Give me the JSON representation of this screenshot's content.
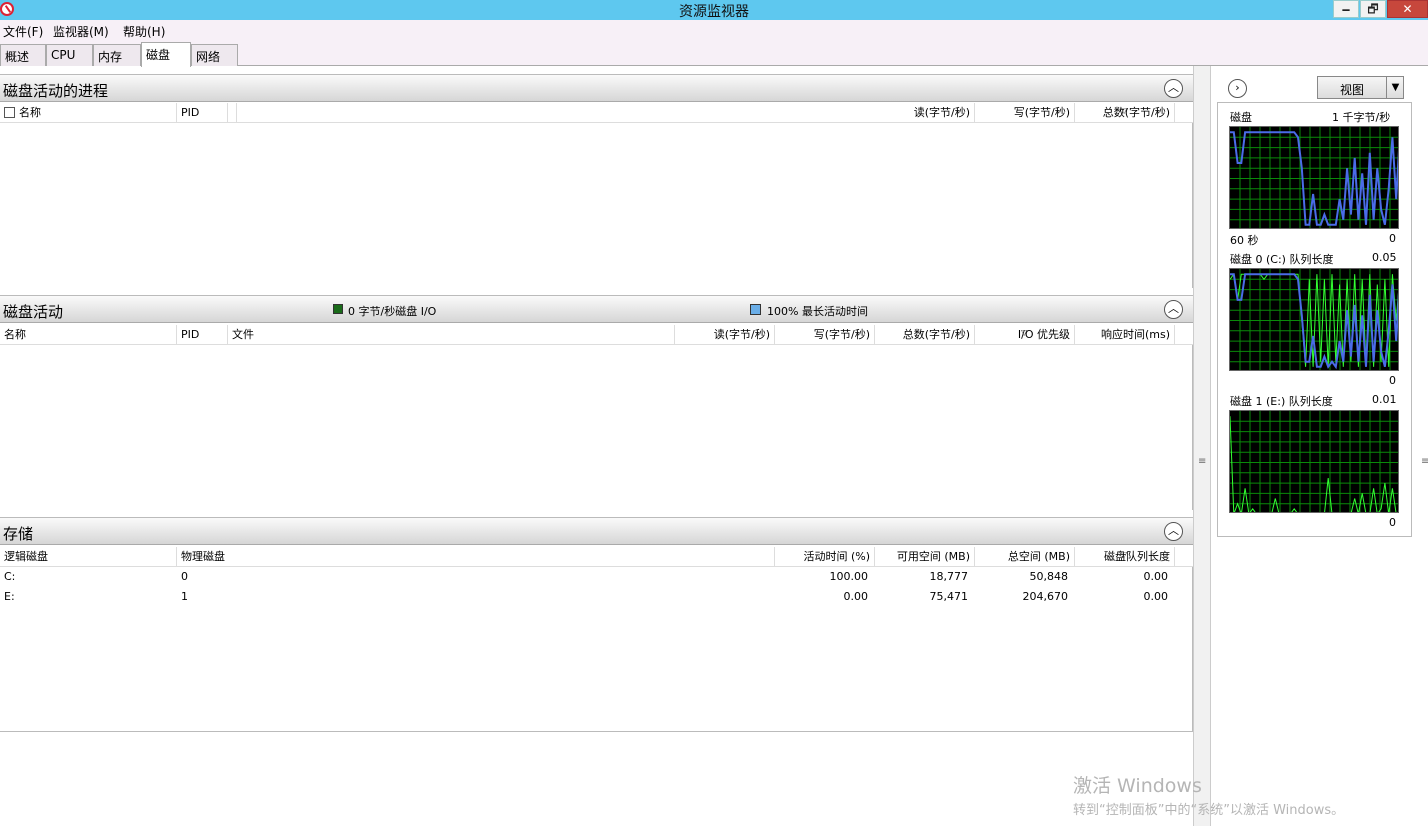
{
  "window": {
    "title": "资源监视器",
    "minimize": "🗕",
    "restore": "🗗",
    "close": "✕"
  },
  "menu": [
    "文件(F)",
    "监视器(M)",
    "帮助(H)"
  ],
  "tabs": [
    "概述",
    "CPU",
    "内存",
    "磁盘",
    "网络"
  ],
  "active_tab": "磁盘",
  "processes": {
    "title": "磁盘活动的进程",
    "columns": [
      "名称",
      "PID",
      "读(字节/秒)",
      "写(字节/秒)",
      "总数(字节/秒)"
    ]
  },
  "activity": {
    "title": "磁盘活动",
    "legend_io": "0 字节/秒磁盘 I/O",
    "legend_active": "100% 最长活动时间",
    "legend_io_color": "#1a6b1a",
    "legend_active_color": "#6aaee8",
    "columns": [
      "名称",
      "PID",
      "文件",
      "读(字节/秒)",
      "写(字节/秒)",
      "总数(字节/秒)",
      "I/O 优先级",
      "响应时间(ms)"
    ]
  },
  "storage": {
    "title": "存储",
    "columns": [
      "逻辑磁盘",
      "物理磁盘",
      "活动时间 (%)",
      "可用空间 (MB)",
      "总空间 (MB)",
      "磁盘队列长度"
    ],
    "rows": [
      {
        "logical": "C:",
        "physical": "0",
        "active": "100.00",
        "free": "18,777",
        "total": "50,848",
        "queue": "0.00"
      },
      {
        "logical": "E:",
        "physical": "1",
        "active": "0.00",
        "free": "75,471",
        "total": "204,670",
        "queue": "0.00"
      }
    ]
  },
  "right": {
    "view_label": "视图",
    "graphs": [
      {
        "label": "磁盘",
        "scale": "1 千字节/秒",
        "left_bottom": "60 秒",
        "right_bottom": "0"
      },
      {
        "label": "磁盘 0 (C:) 队列长度",
        "scale": "0.05",
        "left_bottom": "",
        "right_bottom": "0"
      },
      {
        "label": "磁盘 1 (E:) 队列长度",
        "scale": "0.01",
        "left_bottom": "",
        "right_bottom": "0"
      }
    ],
    "grid_color": "#0a8a0a",
    "green_line_color": "#33ff33",
    "blue_line_color": "#4a6ce8",
    "series": {
      "g1_blue": [
        0.95,
        0.95,
        0.65,
        0.65,
        0.95,
        0.95,
        0.95,
        0.95,
        0.95,
        0.95,
        0.95,
        0.95,
        0.95,
        0.95,
        0.95,
        0.95,
        0.95,
        0.95,
        0.9,
        0.6,
        0.05,
        0.05,
        0.35,
        0.05,
        0.05,
        0.15,
        0.05,
        0.05,
        0.05,
        0.3,
        0.1,
        0.6,
        0.15,
        0.7,
        0.1,
        0.55,
        0.05,
        0.75,
        0.1,
        0.6,
        0.2,
        0.05,
        0.4,
        0.9,
        0.3,
        0.95
      ],
      "g2_green": [
        0.9,
        0.95,
        0.7,
        0.95,
        0.95,
        0.95,
        0.95,
        0.95,
        0.95,
        0.9,
        0.95,
        0.95,
        0.95,
        0.95,
        0.95,
        0.95,
        0.95,
        0.95,
        0.95,
        0.5,
        0.05,
        0.9,
        0.05,
        0.95,
        0.1,
        0.9,
        0.05,
        0.95,
        0.1,
        0.85,
        0.05,
        0.9,
        0.1,
        0.95,
        0.05,
        0.9,
        0.1,
        0.95,
        0.05,
        0.85,
        0.1,
        0.9,
        0.05,
        0.95,
        0.5,
        0.95
      ],
      "g2_blue": [
        0.95,
        0.95,
        0.7,
        0.7,
        0.95,
        0.95,
        0.95,
        0.95,
        0.95,
        0.95,
        0.95,
        0.95,
        0.95,
        0.95,
        0.95,
        0.95,
        0.95,
        0.95,
        0.9,
        0.55,
        0.1,
        0.1,
        0.35,
        0.05,
        0.05,
        0.15,
        0.05,
        0.1,
        0.05,
        0.3,
        0.1,
        0.6,
        0.15,
        0.65,
        0.1,
        0.55,
        0.05,
        0.75,
        0.1,
        0.6,
        0.2,
        0.05,
        0.4,
        0.85,
        0.3,
        0.95
      ],
      "g3_green": [
        0.95,
        0.0,
        0.1,
        0.0,
        0.25,
        0.0,
        0.05,
        0.0,
        0.0,
        0.0,
        0.0,
        0.0,
        0.15,
        0.0,
        0.0,
        0.0,
        0.0,
        0.05,
        0.0,
        0.0,
        0.0,
        0.0,
        0.0,
        0.0,
        0.0,
        0.0,
        0.35,
        0.0,
        0.0,
        0.0,
        0.0,
        0.0,
        0.0,
        0.15,
        0.0,
        0.2,
        0.0,
        0.0,
        0.25,
        0.0,
        0.05,
        0.3,
        0.0,
        0.25,
        0.0,
        0.0
      ]
    }
  },
  "watermark": {
    "line1": "激活 Windows",
    "line2": "转到“控制面板”中的“系统”以激活 Windows。"
  }
}
